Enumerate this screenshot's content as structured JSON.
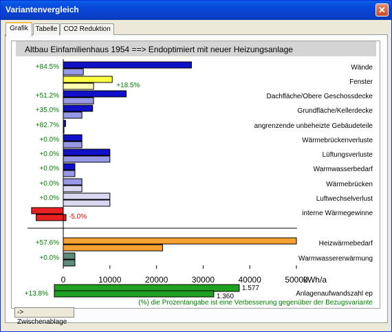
{
  "window": {
    "title": "Variantenvergleich",
    "close_glyph": "✕"
  },
  "tabs": [
    {
      "label": "Grafik",
      "active": true
    },
    {
      "label": "Tabelle",
      "active": false
    },
    {
      "label": "CO2 Reduktion",
      "active": false
    }
  ],
  "chart_title": "Altbau Einfamilienhaus 1954 ==> Endoptimiert mit neuer Heizungsanlage",
  "colors": {
    "dark_blue": "#1010c8",
    "light_blue": "#9898e8",
    "pale_blue": "#d8d8f4",
    "yellow": "#ffff40",
    "pale_yellow": "#ffffb0",
    "red": "#e82020",
    "orange": "#f8a030",
    "gray_green": "#5f8a7a",
    "green": "#20a020",
    "percent_text": "#008000",
    "negative_text": "#e00000"
  },
  "chart_data": {
    "type": "bar",
    "title": "Altbau Einfamilienhaus 1954 ==> Endoptimiert mit neuer Heizungsanlage",
    "x_unit": "kWh/a",
    "x_ticks": [
      "0",
      "10000",
      "20000",
      "30000",
      "40000",
      "50000"
    ],
    "xlim": [
      -7000,
      50000
    ],
    "series": [
      {
        "name": "Altbau",
        "values": [
          27500,
          10500,
          13500,
          6300,
          500,
          4000,
          10000,
          2500,
          4000,
          10000,
          -6800,
          50000,
          2500
        ]
      },
      {
        "name": "Endoptimiert",
        "values": [
          4300,
          6500,
          6500,
          4000,
          90,
          4000,
          10000,
          2500,
          4000,
          10000,
          -6400,
          21300,
          2500
        ]
      }
    ],
    "categories": [
      "Wände",
      "Fenster",
      "Dachfläche/Obere Geschossdecke",
      "Grundfläche/Kellerdecke",
      "angrenzende unbeheizte Gebäudeteile",
      "Wärmebrückenverluste",
      "Lüftungsverluste",
      "Warmwasserbedarf",
      "Wärmebrücken",
      "Luftwechselverlust",
      "interne Wärmegewinne",
      "Heizwärmebedarf",
      "Warmwassererwärmung"
    ],
    "percent_labels": [
      "+84.5%",
      "+18.5%",
      "+51.2%",
      "+35.0%",
      "+82.7%",
      "+0.0%",
      "+0.0%",
      "+0.0%",
      "+0.0%",
      "+0.0%",
      "-5.0%",
      "+57.6%",
      "+0.0%"
    ],
    "anlagen": {
      "label": "Anlagenaufwandszahl ep",
      "percent": "+13.8%",
      "altbau_value": 1.577,
      "optimiert_value": 1.36,
      "altbau_text": "1.577",
      "optimiert_text": "1.360",
      "scale_max": 2.0
    },
    "footnote": "(%) die Prozentangabe ist eine Verbesserung gegenüber der Bezugsvariante"
  },
  "clipboard_button": "-> Zwischenablage"
}
